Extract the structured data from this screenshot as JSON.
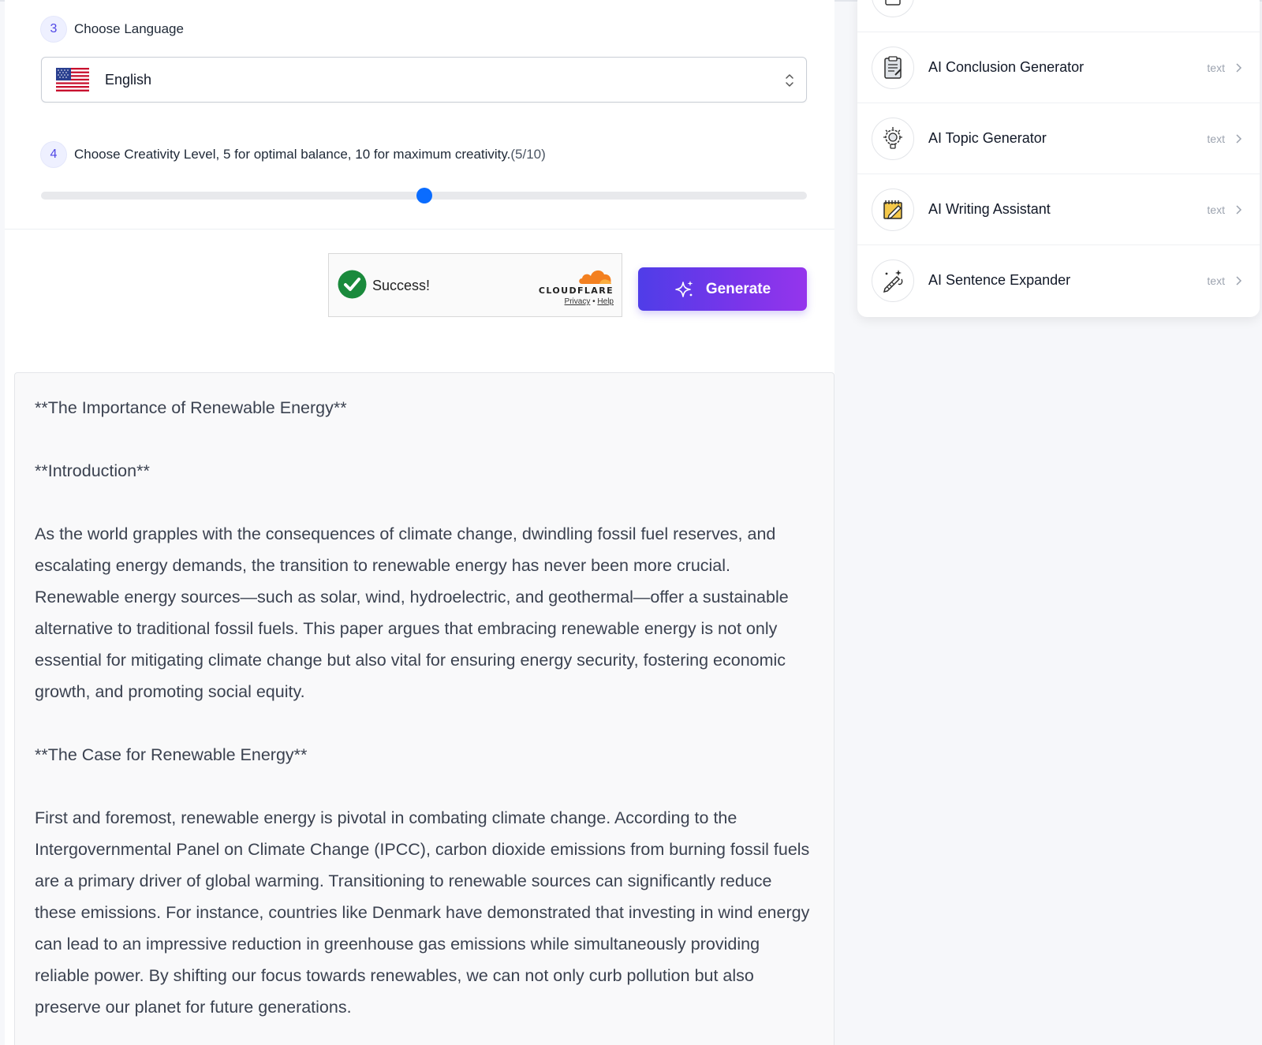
{
  "steps": {
    "language": {
      "number": "3",
      "label": "Choose Language"
    },
    "creativity": {
      "number": "4",
      "label": "Choose Creativity Level, 5 for optimal balance, 10 for maximum creativity.",
      "level": "(5/10)"
    }
  },
  "language_select": {
    "selected": "English",
    "flag_icon": "us-flag-icon"
  },
  "creativity_slider": {
    "value": 5,
    "max": 10
  },
  "captcha": {
    "status": "Success!",
    "provider": "CLOUDFLARE",
    "privacy": "Privacy",
    "separator": "•",
    "help": "Help"
  },
  "generate_button": {
    "label": "Generate",
    "color_start": "#4f3de8",
    "color_end": "#9535ec"
  },
  "output": {
    "paragraphs": [
      "**The Importance of Renewable Energy**",
      "**Introduction**",
      "As the world grapples with the consequences of climate change, dwindling fossil fuel reserves, and escalating energy demands, the transition to renewable energy has never been more crucial. Renewable energy sources—such as solar, wind, hydroelectric, and geothermal—offer a sustainable alternative to traditional fossil fuels. This paper argues that embracing renewable energy is not only essential for mitigating climate change but also vital for ensuring energy security, fostering economic growth, and promoting social equity.",
      "**The Case for Renewable Energy**",
      "First and foremost, renewable energy is pivotal in combating climate change. According to the Intergovernmental Panel on Climate Change (IPCC), carbon dioxide emissions from burning fossil fuels are a primary driver of global warming. Transitioning to renewable sources can significantly reduce these emissions. For instance, countries like Denmark have demonstrated that investing in wind energy can lead to an impressive reduction in greenhouse gas emissions while simultaneously providing reliable power. By shifting our focus towards renewables, we can not only curb pollution but also preserve our planet for future generations."
    ]
  },
  "tools": [
    {
      "name": "AI Conclusion Generator",
      "type": "text",
      "icon": "conclusion-document-icon"
    },
    {
      "name": "AI Topic Generator",
      "type": "text",
      "icon": "lightbulb-gear-icon"
    },
    {
      "name": "AI Writing Assistant",
      "type": "text",
      "icon": "notepad-pencil-icon"
    },
    {
      "name": "AI Sentence Expander",
      "type": "text",
      "icon": "magic-pen-icon"
    }
  ]
}
